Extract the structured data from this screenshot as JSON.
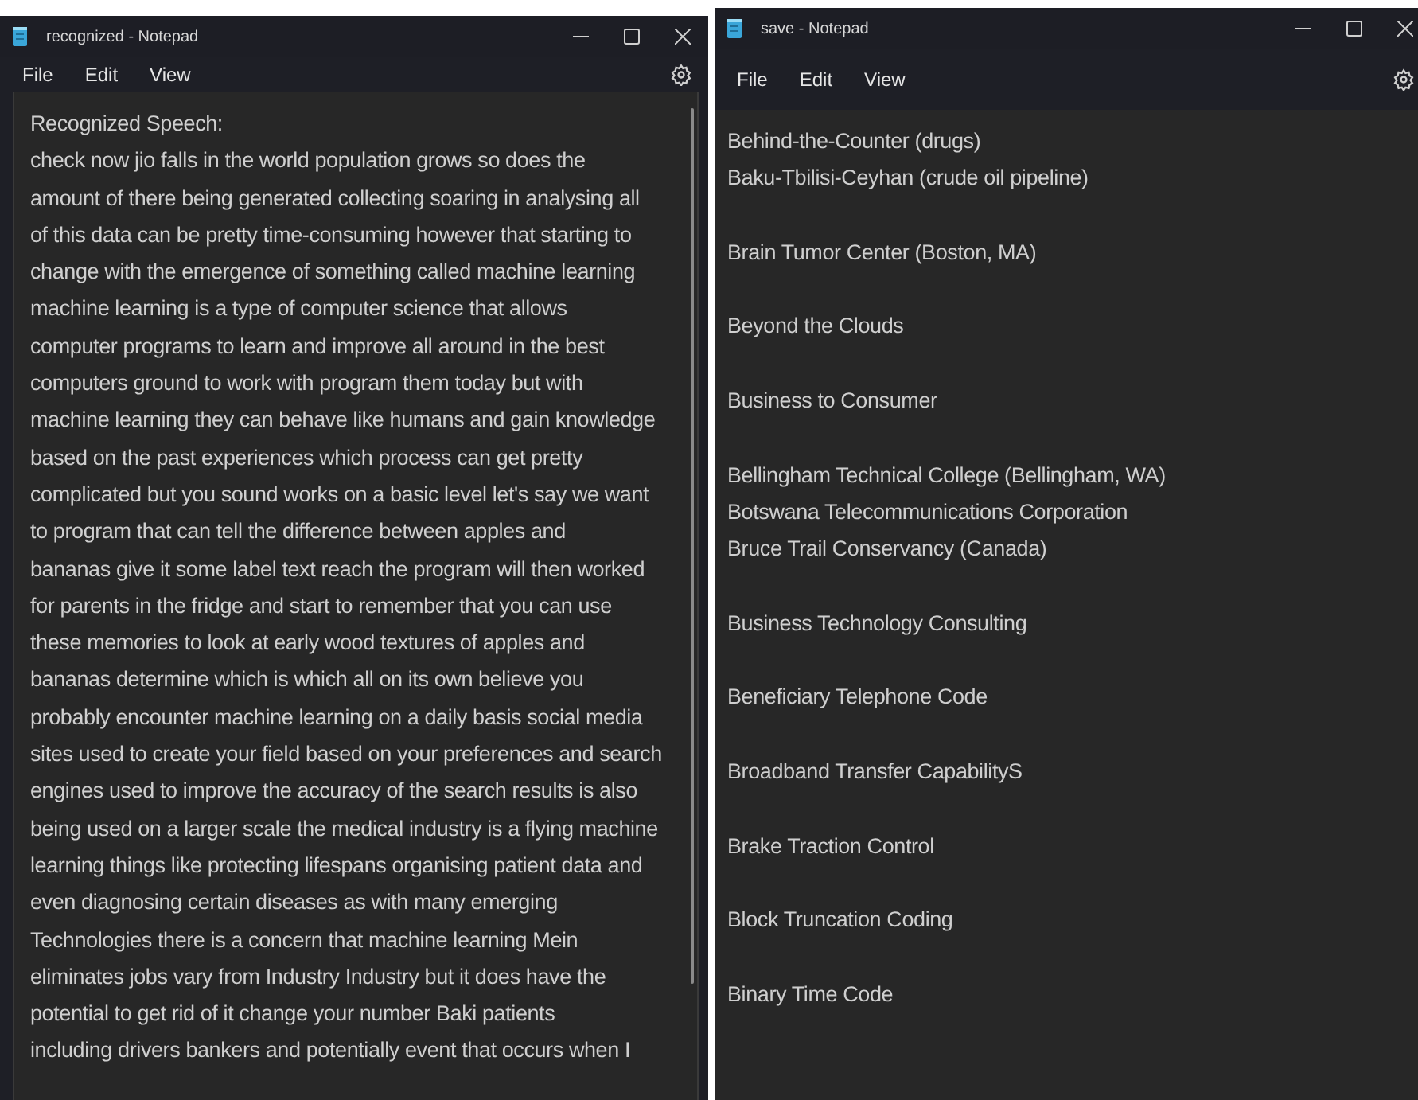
{
  "windows": [
    {
      "title": "recognized - Notepad",
      "menu": [
        "File",
        "Edit",
        "View"
      ],
      "scrollbar_visible": true,
      "paragraphs": [
        [
          "Recognized Speech:",
          "check now jio falls in the world population grows so does the",
          "amount of there being generated collecting soaring in analysing all",
          "of this data can be pretty time-consuming however that starting to",
          "change with the emergence of something called machine learning",
          "machine learning is a type of computer science that allows",
          "computer programs to learn and improve all around in the best",
          "computers ground to work with program them today but with",
          "machine learning they can behave like humans and gain knowledge",
          "based on the past experiences which process can get pretty",
          "complicated but you sound works on a basic level let's say we want",
          "to program that can tell the difference between apples and",
          "bananas give it some label text reach the program will then worked",
          "for parents in the fridge and start to remember that you can use",
          "these memories to look at early wood textures of apples and",
          "bananas determine which is which all on its own believe you",
          "probably encounter machine learning on a daily basis social media",
          "sites used to create your field based on your preferences and search",
          "engines used to improve the accuracy of the search results is also",
          "being used on a larger scale the medical industry is a flying machine",
          "learning things like protecting lifespans organising patient data and",
          "even diagnosing certain diseases as with many emerging",
          "Technologies there is a concern that machine learning Mein",
          "eliminates jobs vary from Industry Industry but it does have the",
          "potential to get rid of it change your number Baki patients",
          "including drivers bankers and potentially event that occurs when I"
        ]
      ]
    },
    {
      "title": "save - Notepad",
      "menu": [
        "File",
        "Edit",
        "View"
      ],
      "scrollbar_visible": false,
      "paragraphs": [
        [
          "Behind-the-Counter (drugs)",
          "Baku-Tbilisi-Ceyhan (crude oil pipeline)"
        ],
        [
          "Brain Tumor Center (Boston, MA)"
        ],
        [
          "Beyond the Clouds"
        ],
        [
          "Business to Consumer"
        ],
        [
          "Bellingham Technical College (Bellingham, WA)",
          "Botswana Telecommunications Corporation",
          "Bruce Trail Conservancy (Canada)"
        ],
        [
          "Business Technology Consulting"
        ],
        [
          "Beneficiary Telephone Code"
        ],
        [
          "Broadband Transfer CapabilityS"
        ],
        [
          "Brake Traction Control"
        ],
        [
          "Block Truncation Coding"
        ],
        [
          "Binary Time Code"
        ]
      ]
    }
  ]
}
